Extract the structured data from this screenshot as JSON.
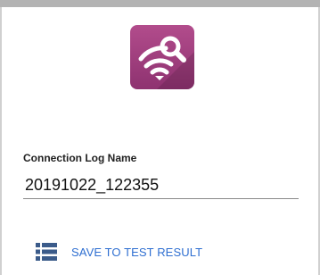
{
  "form": {
    "log_name_label": "Connection Log Name",
    "log_name_value": "20191022_122355"
  },
  "actions": {
    "save_label": "SAVE TO TEST RESULT"
  },
  "icons": {
    "app": "wifi-search-icon",
    "save": "list-icon"
  },
  "colors": {
    "icon_bg_top": "#b04a8a",
    "icon_bg_bottom": "#8a2f6e",
    "accent": "#2f6fd1",
    "save_icon": "#3b5b8a"
  }
}
